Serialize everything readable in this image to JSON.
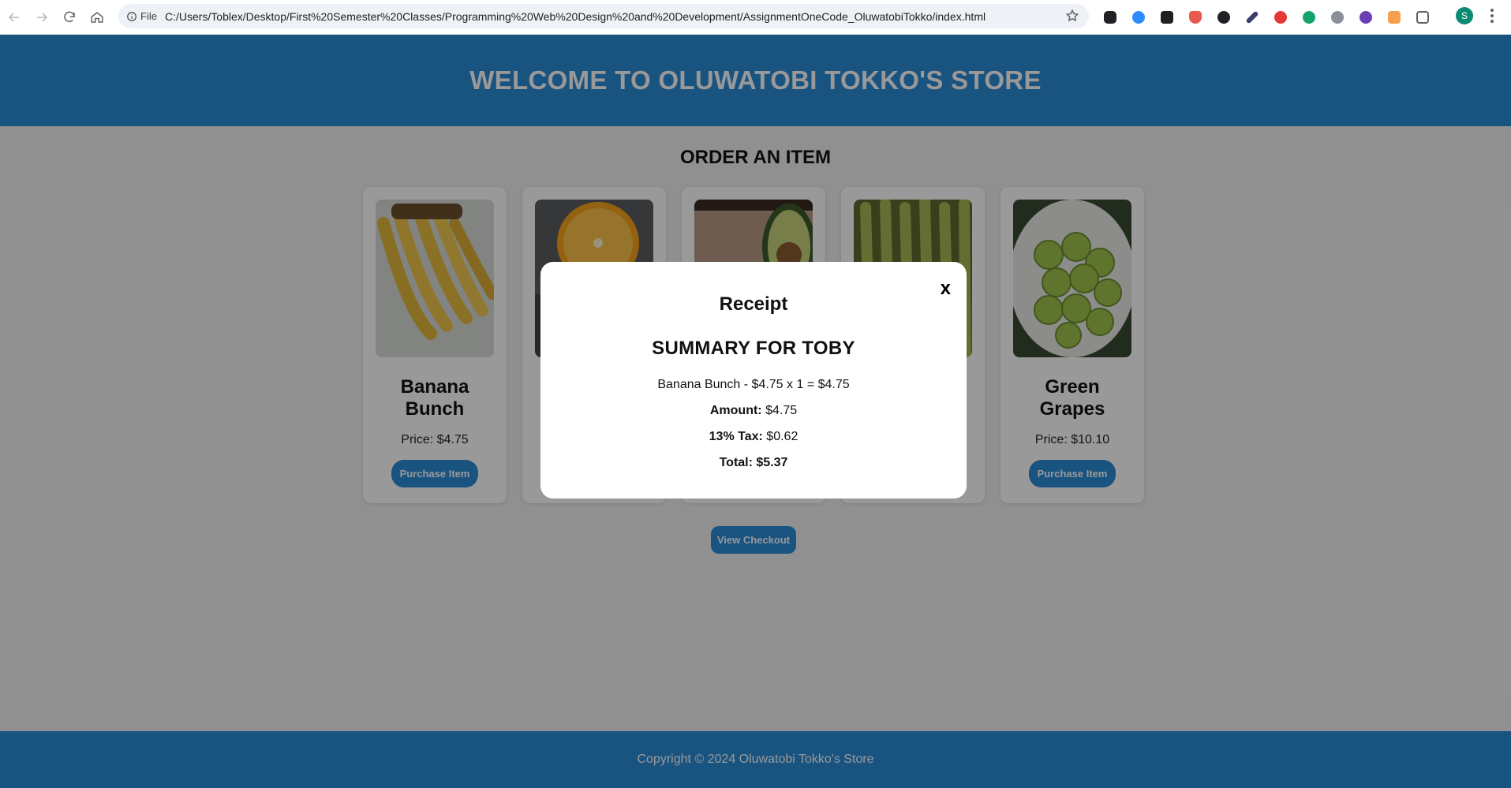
{
  "browser": {
    "file_label": "File",
    "url": "C:/Users/Toblex/Desktop/First%20Semester%20Classes/Programming%20Web%20Design%20and%20Development/AssignmentOneCode_OluwatobiTokko/index.html",
    "profile_initial": "S"
  },
  "header": {
    "title": "WELCOME TO OLUWATOBI TOKKO'S STORE"
  },
  "main": {
    "order_heading": "ORDER AN ITEM",
    "products": [
      {
        "name": "Banana Bunch",
        "price": "Price: $4.75",
        "button": "Purchase Item"
      },
      {
        "name": "",
        "price": "",
        "button": ""
      },
      {
        "name": "",
        "price": "",
        "button": ""
      },
      {
        "name": "",
        "price": "",
        "button": ""
      },
      {
        "name": "Green Grapes",
        "price": "Price: $10.10",
        "button": "Purchase Item"
      }
    ],
    "checkout_button": "View Checkout"
  },
  "footer": {
    "text": "Copyright © 2024 Oluwatobi Tokko's Store"
  },
  "modal": {
    "close": "x",
    "title": "Receipt",
    "summary": "SUMMARY FOR TOBY",
    "line_item": "Banana Bunch - $4.75 x 1 = $4.75",
    "amount_label": "Amount:",
    "amount_value": "$4.75",
    "tax_label": "13% Tax:",
    "tax_value": "$0.62",
    "total": "Total: $5.37"
  },
  "colors": {
    "brand_blue": "#2a8ad6",
    "overlay": "rgba(0,0,0,0.4)"
  }
}
